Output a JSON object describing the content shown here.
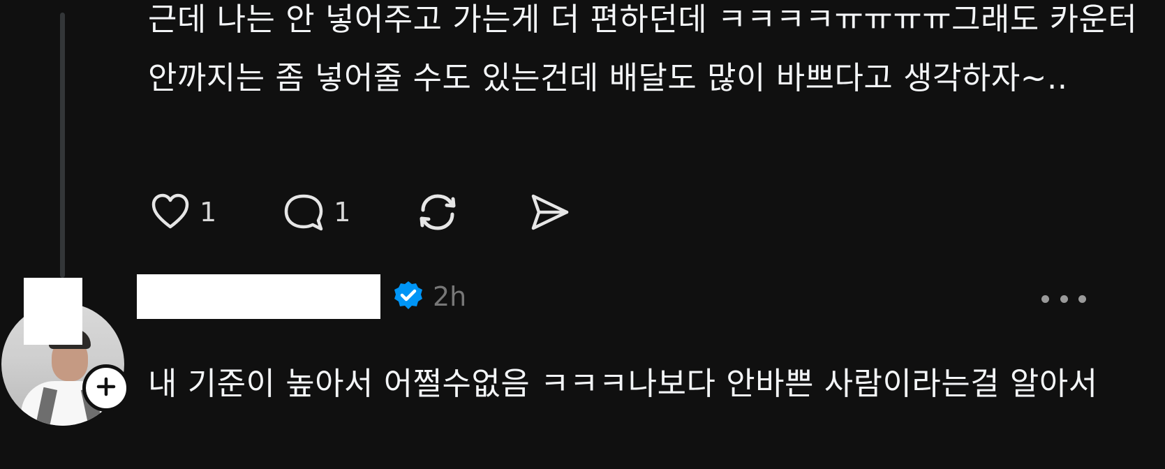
{
  "first_post": {
    "text": "근데 나는 안 넣어주고 가는게 더 편하던데 ㅋㅋㅋㅋㅠㅠㅠㅠ그래도 카운터 안까지는 좀 넣어줄 수도 있는건데 배달도 많이 바쁘다고 생각하자~..",
    "likes": "1",
    "replies": "1"
  },
  "second_post": {
    "timestamp": "2h",
    "text": "내 기준이 높아서 어쩔수없음 ㅋㅋㅋ나보다 안바쁜 사람이라는걸 알아서"
  },
  "icons": {
    "like": "heart-icon",
    "reply": "comment-icon",
    "repost": "repost-icon",
    "share": "send-icon",
    "verified": "verified-badge-icon",
    "follow": "plus-icon",
    "more": "more-options-icon"
  },
  "colors": {
    "background": "#101010",
    "text": "#f3f5f7",
    "muted": "#777777",
    "verified": "#0095f6"
  }
}
